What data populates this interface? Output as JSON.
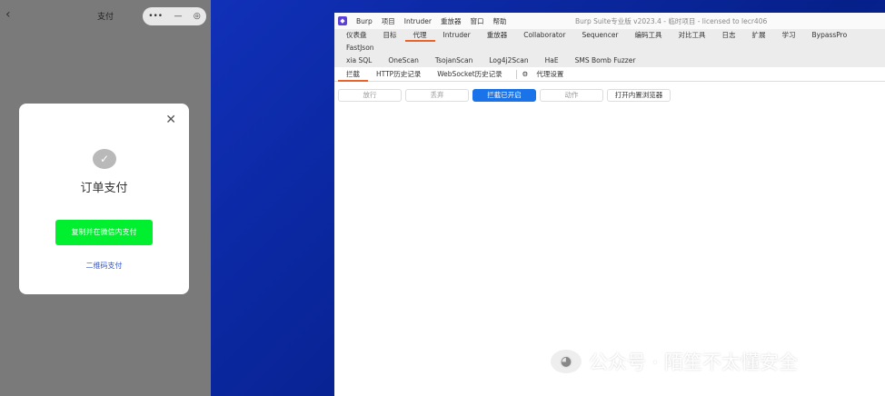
{
  "phone": {
    "title": "支付",
    "back_icon": "chevron-left",
    "capsule": [
      "•••",
      "—",
      "◎"
    ],
    "modal": {
      "title": "订单支付",
      "pay_button": "复制并在微信内支付",
      "qr_link": "二维码支付",
      "close": "✕"
    }
  },
  "burp": {
    "menu": [
      "Burp",
      "项目",
      "Intruder",
      "重放器",
      "窗口",
      "帮助"
    ],
    "window_title": "Burp Suite专业版 v2023.4 - 临时项目 - licensed to lecr406",
    "tabs": [
      "仪表盘",
      "目标",
      "代理",
      "Intruder",
      "重放器",
      "Collaborator",
      "Sequencer",
      "编码工具",
      "对比工具",
      "日志",
      "扩展",
      "学习",
      "BypassPro",
      "FastJson"
    ],
    "tabs2": [
      "xia SQL",
      "OneScan",
      "TsojanScan",
      "Log4j2Scan",
      "HaE",
      "SMS Bomb Fuzzer"
    ],
    "subtabs": [
      "拦截",
      "HTTP历史记录",
      "WebSocket历史记录"
    ],
    "proxy_settings": "代理设置",
    "buttons": [
      "放行",
      "丢弃",
      "拦截已开启",
      "动作",
      "打开内置浏览器"
    ]
  },
  "watermark": "公众号 · 陌笙不太懂安全"
}
